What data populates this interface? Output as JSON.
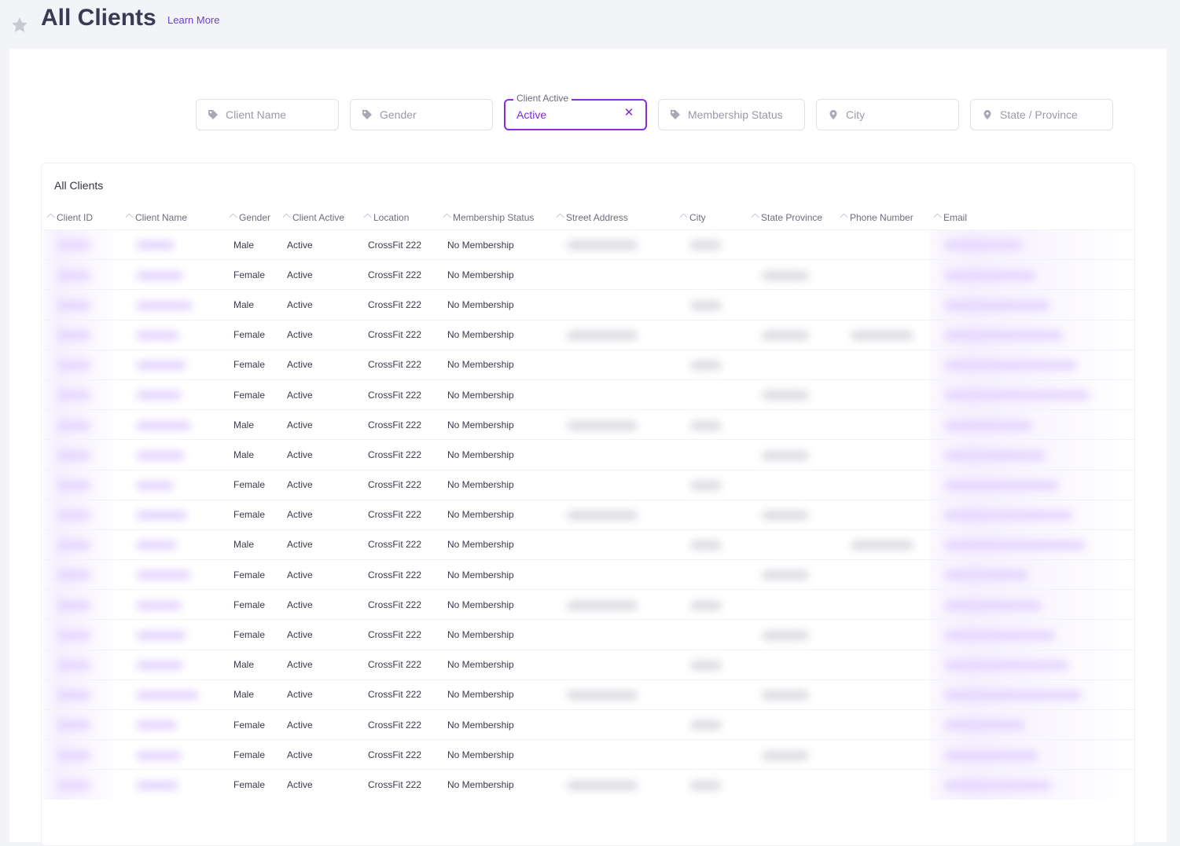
{
  "header": {
    "title": "All Clients",
    "learn_more": "Learn More"
  },
  "filters": [
    {
      "name": "client-name-filter",
      "placeholder": "Client Name",
      "icon": "tag-icon"
    },
    {
      "name": "gender-filter",
      "placeholder": "Gender",
      "icon": "tag-icon"
    },
    {
      "name": "client-active-filter",
      "label": "Client Active",
      "value": "Active",
      "icon": "close-icon"
    },
    {
      "name": "membership-status-filter",
      "placeholder": "Membership Status",
      "icon": "tag-icon"
    },
    {
      "name": "city-filter",
      "placeholder": "City",
      "icon": "location-pin-icon"
    },
    {
      "name": "state-province-filter",
      "placeholder": "State / Province",
      "icon": "location-pin-icon"
    }
  ],
  "table": {
    "title": "All Clients",
    "columns": [
      "Client ID",
      "Client Name",
      "Gender",
      "Client Active",
      "Location",
      "Membership Status",
      "Street Address",
      "City",
      "State Province",
      "Phone Number",
      "Email"
    ],
    "rows": [
      {
        "gender": "Male",
        "active": "Active",
        "location": "CrossFit 222",
        "membership": "No Membership"
      },
      {
        "gender": "Female",
        "active": "Active",
        "location": "CrossFit 222",
        "membership": "No Membership"
      },
      {
        "gender": "Male",
        "active": "Active",
        "location": "CrossFit 222",
        "membership": "No Membership"
      },
      {
        "gender": "Female",
        "active": "Active",
        "location": "CrossFit 222",
        "membership": "No Membership"
      },
      {
        "gender": "Female",
        "active": "Active",
        "location": "CrossFit 222",
        "membership": "No Membership"
      },
      {
        "gender": "Female",
        "active": "Active",
        "location": "CrossFit 222",
        "membership": "No Membership"
      },
      {
        "gender": "Male",
        "active": "Active",
        "location": "CrossFit 222",
        "membership": "No Membership"
      },
      {
        "gender": "Male",
        "active": "Active",
        "location": "CrossFit 222",
        "membership": "No Membership"
      },
      {
        "gender": "Female",
        "active": "Active",
        "location": "CrossFit 222",
        "membership": "No Membership"
      },
      {
        "gender": "Female",
        "active": "Active",
        "location": "CrossFit 222",
        "membership": "No Membership"
      },
      {
        "gender": "Male",
        "active": "Active",
        "location": "CrossFit 222",
        "membership": "No Membership"
      },
      {
        "gender": "Female",
        "active": "Active",
        "location": "CrossFit 222",
        "membership": "No Membership"
      },
      {
        "gender": "Female",
        "active": "Active",
        "location": "CrossFit 222",
        "membership": "No Membership"
      },
      {
        "gender": "Female",
        "active": "Active",
        "location": "CrossFit 222",
        "membership": "No Membership"
      },
      {
        "gender": "Male",
        "active": "Active",
        "location": "CrossFit 222",
        "membership": "No Membership"
      },
      {
        "gender": "Male",
        "active": "Active",
        "location": "CrossFit 222",
        "membership": "No Membership"
      },
      {
        "gender": "Female",
        "active": "Active",
        "location": "CrossFit 222",
        "membership": "No Membership"
      },
      {
        "gender": "Female",
        "active": "Active",
        "location": "CrossFit 222",
        "membership": "No Membership"
      },
      {
        "gender": "Female",
        "active": "Active",
        "location": "CrossFit 222",
        "membership": "No Membership"
      }
    ]
  },
  "colors": {
    "accent": "#8a2be2",
    "link": "#6b3fd6",
    "background": "#f3f4f7"
  }
}
